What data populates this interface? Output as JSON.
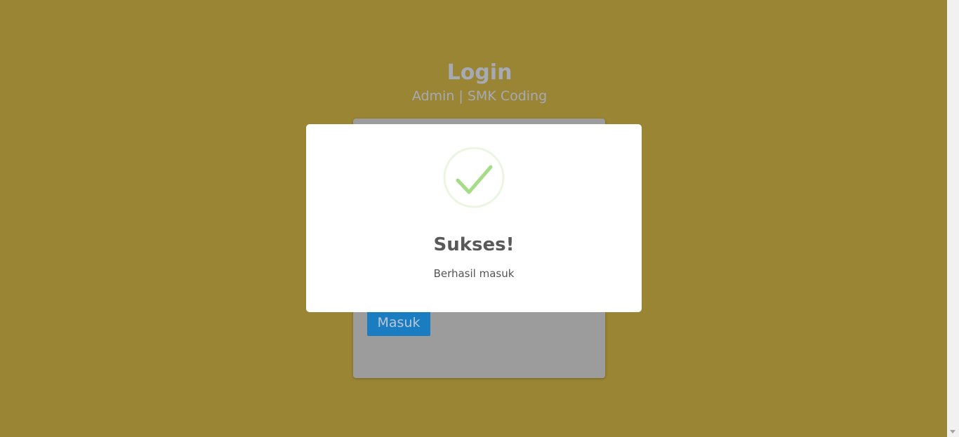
{
  "login": {
    "title": "Login",
    "subtitle": "Admin | SMK Coding",
    "submit_label": "Masuk"
  },
  "modal": {
    "icon": "check-circle-icon",
    "title": "Sukses!",
    "text": "Berhasil masuk"
  },
  "colors": {
    "backdrop": "#998533",
    "accent_button": "#1a7cc1",
    "success_green": "#a5dc86",
    "modal_bg": "#ffffff"
  }
}
